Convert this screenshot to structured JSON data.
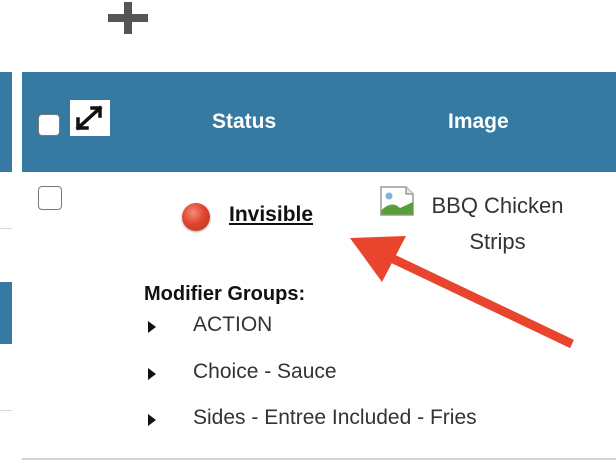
{
  "table": {
    "headers": {
      "status": "Status",
      "image": "Image"
    }
  },
  "row": {
    "status_label": "Invisible",
    "status_color": "#e0452f",
    "item_name": "BBQ Chicken Strips"
  },
  "modifiers": {
    "title": "Modifier Groups:",
    "items": [
      {
        "label": "ACTION"
      },
      {
        "label": "Choice - Sauce"
      },
      {
        "label": "Sides - Entree Included - Fries"
      }
    ]
  },
  "colors": {
    "header_bg": "#367aa1",
    "annotation_arrow": "#e8442e"
  },
  "icons": {
    "add": "plus-icon",
    "expand": "expand-arrows-icon",
    "broken_image": "broken-image-icon",
    "status": "status-dot-icon",
    "caret": "caret-right-icon"
  }
}
